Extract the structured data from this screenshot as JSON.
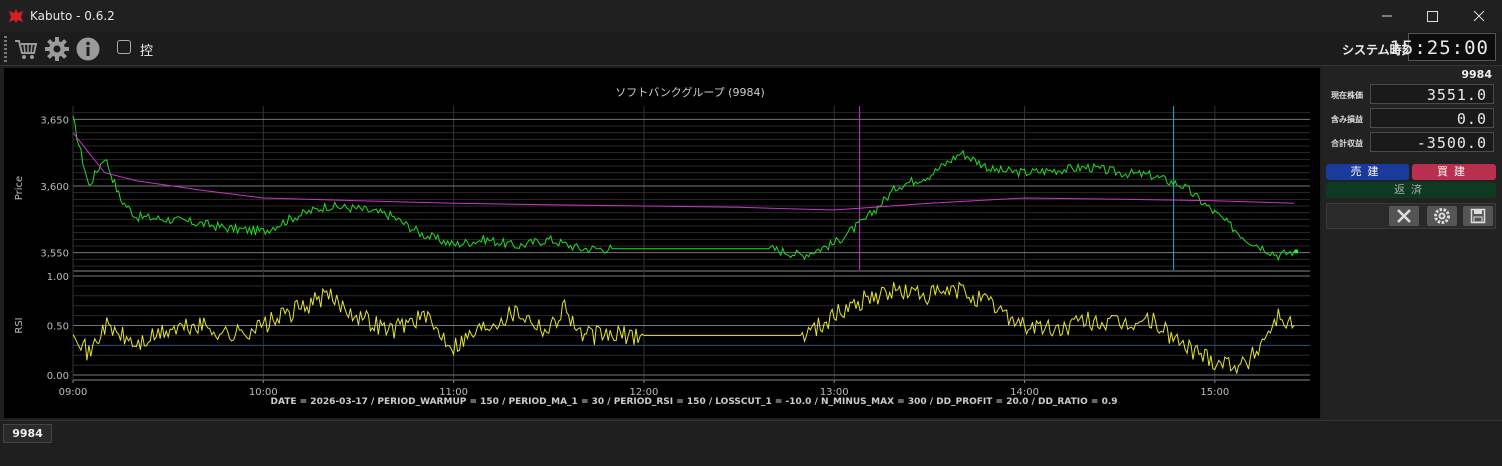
{
  "app": {
    "title": "Kabuto - 0.6.2"
  },
  "window_controls": {
    "minimize": "minimize-icon",
    "maximize": "maximize-icon",
    "close": "close-icon"
  },
  "toolbar": {
    "icons": [
      "cart-icon",
      "gear-icon",
      "info-icon"
    ],
    "checkbox_label": "控",
    "checkbox_checked": false,
    "clock_label": "システム時刻",
    "clock_value": "15:25:00"
  },
  "side_panel": {
    "code": "9984",
    "rows": [
      {
        "label": "現在株価",
        "value": "3551.0"
      },
      {
        "label": "含み損益",
        "value": "0.0"
      },
      {
        "label": "合計収益",
        "value": "-3500.0"
      }
    ],
    "sell_label": "売建",
    "buy_label": "買建",
    "repay_label": "返済",
    "tool_icons": [
      "tools-icon",
      "gear-icon",
      "save-icon"
    ],
    "colors": {
      "sell": "#1a3a9e",
      "buy": "#b8304d",
      "repay": "#0f3a22"
    }
  },
  "status_tab": "9984",
  "chart_data": [
    {
      "type": "line",
      "title": "ソフトバンクグループ (9984)",
      "ylabel": "Price",
      "ylim": [
        3537,
        3660
      ],
      "yticks": [
        3650,
        3600,
        3550
      ],
      "ytick_labels": [
        "3,650",
        "3,600",
        "3,550"
      ],
      "xlim": [
        "09:00",
        "15:30"
      ],
      "grid": true,
      "series": [
        {
          "color": "#22dd22",
          "style": "price",
          "x": [
            "09:00",
            "09:05",
            "09:10",
            "09:15",
            "09:20",
            "09:30",
            "09:40",
            "09:50",
            "10:00",
            "10:10",
            "10:20",
            "10:30",
            "10:40",
            "10:50",
            "11:00",
            "11:10",
            "11:20",
            "11:30",
            "11:40",
            "11:50",
            "12:00",
            "12:10",
            "12:20",
            "12:30",
            "12:40",
            "12:50",
            "13:00",
            "13:10",
            "13:20",
            "13:30",
            "13:40",
            "13:50",
            "14:00",
            "14:10",
            "14:20",
            "14:30",
            "14:40",
            "14:50",
            "15:00",
            "15:10",
            "15:20",
            "15:25"
          ],
          "y": [
            3650,
            3600,
            3622,
            3590,
            3577,
            3575,
            3572,
            3568,
            3566,
            3577,
            3585,
            3583,
            3578,
            3564,
            3556,
            3560,
            3555,
            3560,
            3553,
            3553,
            3553,
            3553,
            3553,
            3553,
            3553,
            3548,
            3557,
            3575,
            3600,
            3608,
            3625,
            3612,
            3610,
            3612,
            3614,
            3610,
            3608,
            3600,
            3580,
            3560,
            3548,
            3551
          ]
        },
        {
          "color": "#cc33cc",
          "style": "ma",
          "x": [
            "09:00",
            "09:10",
            "09:20",
            "09:40",
            "10:00",
            "10:30",
            "11:00",
            "11:30",
            "12:00",
            "12:30",
            "13:00",
            "13:30",
            "14:00",
            "14:30",
            "15:00",
            "15:25"
          ],
          "y": [
            3640,
            3610,
            3604,
            3597,
            3591,
            3589,
            3587,
            3586,
            3585,
            3584,
            3582,
            3587,
            3591,
            3590,
            3589,
            3587
          ]
        }
      ],
      "vlines": [
        {
          "x": "13:08",
          "color": "#cc33cc"
        },
        {
          "x": "14:47",
          "color": "#22aadd"
        }
      ]
    },
    {
      "type": "line",
      "ylabel": "RSI",
      "ylim": [
        -0.05,
        1.05
      ],
      "yticks": [
        1.0,
        0.5,
        0.0
      ],
      "ytick_labels": [
        "1.00",
        "0.50",
        "0.00"
      ],
      "xticks": [
        "09:00",
        "10:00",
        "11:00",
        "12:00",
        "13:00",
        "14:00",
        "15:00"
      ],
      "xlim": [
        "09:00",
        "15:30"
      ],
      "grid": true,
      "series": [
        {
          "color": "#e6e62a",
          "x": [
            "09:00",
            "09:05",
            "09:10",
            "09:20",
            "09:30",
            "09:40",
            "09:50",
            "10:00",
            "10:10",
            "10:20",
            "10:30",
            "10:40",
            "10:50",
            "11:00",
            "11:10",
            "11:20",
            "11:30",
            "11:35",
            "11:40",
            "12:00",
            "12:30",
            "12:50",
            "13:00",
            "13:10",
            "13:20",
            "13:30",
            "13:40",
            "13:50",
            "14:00",
            "14:10",
            "14:20",
            "14:30",
            "14:40",
            "14:50",
            "15:00",
            "15:10",
            "15:20",
            "15:25"
          ],
          "y": [
            0.5,
            0.2,
            0.5,
            0.3,
            0.45,
            0.5,
            0.4,
            0.5,
            0.65,
            0.8,
            0.6,
            0.45,
            0.6,
            0.3,
            0.5,
            0.65,
            0.45,
            0.7,
            0.4,
            0.4,
            0.4,
            0.4,
            0.6,
            0.78,
            0.85,
            0.8,
            0.85,
            0.7,
            0.5,
            0.45,
            0.55,
            0.5,
            0.55,
            0.3,
            0.15,
            0.1,
            0.6,
            0.5
          ]
        }
      ]
    }
  ],
  "chart_footer": "DATE = 2026-03-17 / PERIOD_WARMUP = 150 / PERIOD_MA_1 = 30 / PERIOD_RSI = 150 / LOSSCUT_1 = -10.0 / N_MINUS_MAX = 300 / DD_PROFIT = 20.0 / DD_RATIO = 0.9"
}
